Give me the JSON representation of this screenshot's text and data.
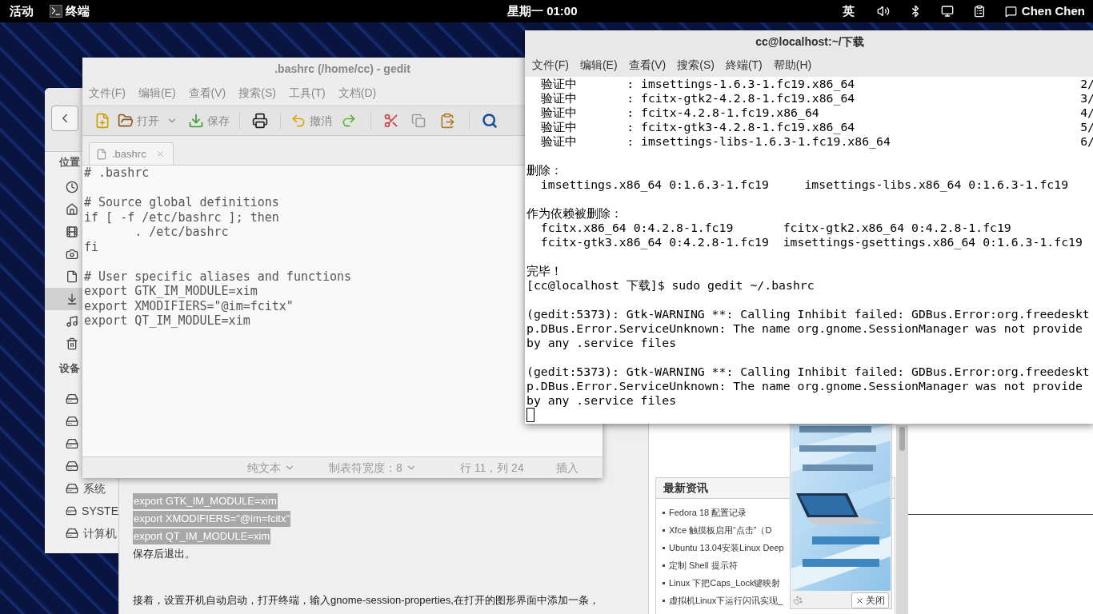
{
  "top_bar": {
    "activities": "活动",
    "app": "终端",
    "clock": "星期一 01:00",
    "input_method": "英",
    "user": "Chen Chen"
  },
  "file_manager": {
    "sections": [
      {
        "title": "位置",
        "items": [
          {
            "selected": false
          },
          {
            "selected": false
          },
          {
            "selected": false
          },
          {
            "selected": false
          },
          {
            "selected": false
          },
          {
            "selected": true
          },
          {
            "selected": false
          },
          {
            "selected": false
          }
        ]
      },
      {
        "title": "设备",
        "items": [
          {
            "selected": false
          },
          {
            "selected": false
          },
          {
            "selected": false
          },
          {
            "selected": false
          },
          {
            "label": "系统",
            "selected": false
          },
          {
            "label": "SYSTE",
            "selected": false
          },
          {
            "label": "计算机",
            "selected": false
          }
        ]
      }
    ]
  },
  "browser": {
    "code_lines": [
      "export GTK_IM_MODULE=xim",
      "export XMODIFIERS=\"@im=fcitx\"",
      "export QT_IM_MODULE=xim"
    ],
    "after_text": "保存后退出。",
    "next_text": "接着，设置开机自动启动，打开终端，输入gnome-session-properties,在打开的图形界面中添加一条，",
    "news": {
      "title": "最新资讯",
      "items": [
        "Fedora 18 配置记录",
        "Xfce 触摸板启用“点击”（D",
        "Ubuntu 13.04安装Linux Deep",
        "定制 Shell 提示符",
        "Linux 下把Caps_Lock键映射",
        "虚拟机Linux下运行闪讯实现_"
      ]
    },
    "ad": {
      "kind": "picture",
      "close": "关闭"
    }
  },
  "gedit": {
    "title": ".bashrc (/home/cc) - gedit",
    "focused": false,
    "menu": [
      "文件(F)",
      "编辑(E)",
      "查看(V)",
      "搜索(S)",
      "工具(T)",
      "文档(D)"
    ],
    "toolbar": {
      "open": "打开",
      "save": "保存",
      "undo": "撤消"
    },
    "tab": ".bashrc",
    "blocks": [
      [
        "# .bashrc"
      ],
      [
        "# Source global definitions",
        "if [ -f /etc/bashrc ]; then",
        "       . /etc/bashrc",
        "fi"
      ],
      [
        "# User specific aliases and functions",
        "export GTK_IM_MODULE=xim",
        "export XMODIFIERS=\"@im=fcitx\"",
        "export QT_IM_MODULE=xim"
      ]
    ],
    "status": {
      "syntax": "纯文本",
      "tab_width": "制表符宽度：8",
      "position": "行 11，列 24",
      "mode": "插入"
    }
  },
  "terminal": {
    "title": "cc@localhost:~/下载",
    "focused": true,
    "menu": [
      "文件(F)",
      "编辑(E)",
      "查看(V)",
      "搜索(S)",
      "終端(T)",
      "帮助(H)"
    ],
    "blocks": [
      [
        {
          "text": "  验证中       : imsettings-1.6.3-1.fc19.x86_64",
          "progress": "2/"
        },
        {
          "text": "  验证中       : fcitx-gtk2-4.2.8-1.fc19.x86_64",
          "progress": "3/"
        },
        {
          "text": "  验证中       : fcitx-4.2.8-1.fc19.x86_64",
          "progress": "4/"
        },
        {
          "text": "  验证中       : fcitx-gtk3-4.2.8-1.fc19.x86_64",
          "progress": "5/"
        },
        {
          "text": "  验证中       : imsettings-libs-1.6.3-1.fc19.x86_64",
          "progress": "6/"
        }
      ],
      [
        {
          "text": "删除："
        },
        {
          "text": "  imsettings.x86_64 0:1.6.3-1.fc19     imsettings-libs.x86_64 0:1.6.3-1.fc19"
        }
      ],
      [
        {
          "text": "作为依赖被删除："
        },
        {
          "text": "  fcitx.x86_64 0:4.2.8-1.fc19       fcitx-gtk2.x86_64 0:4.2.8-1.fc19"
        },
        {
          "text": "  fcitx-gtk3.x86_64 0:4.2.8-1.fc19  imsettings-gsettings.x86_64 0:1.6.3-1.fc19"
        }
      ],
      [
        {
          "text": "完毕！"
        },
        {
          "text": "[cc@localhost 下载]$ sudo gedit ~/.bashrc"
        }
      ],
      [
        {
          "text": "(gedit:5373): Gtk-WARNING **: Calling Inhibit failed: GDBus.Error:org.freedeskt"
        },
        {
          "text": "p.DBus.Error.ServiceUnknown: The name org.gnome.SessionManager was not provide"
        },
        {
          "text": "by any .service files"
        }
      ],
      [
        {
          "text": "(gedit:5373): Gtk-WARNING **: Calling Inhibit failed: GDBus.Error:org.freedeskt"
        },
        {
          "text": "p.DBus.Error.ServiceUnknown: The name org.gnome.SessionManager was not provide"
        },
        {
          "text": "by any .service files"
        }
      ]
    ],
    "cursor": true
  }
}
